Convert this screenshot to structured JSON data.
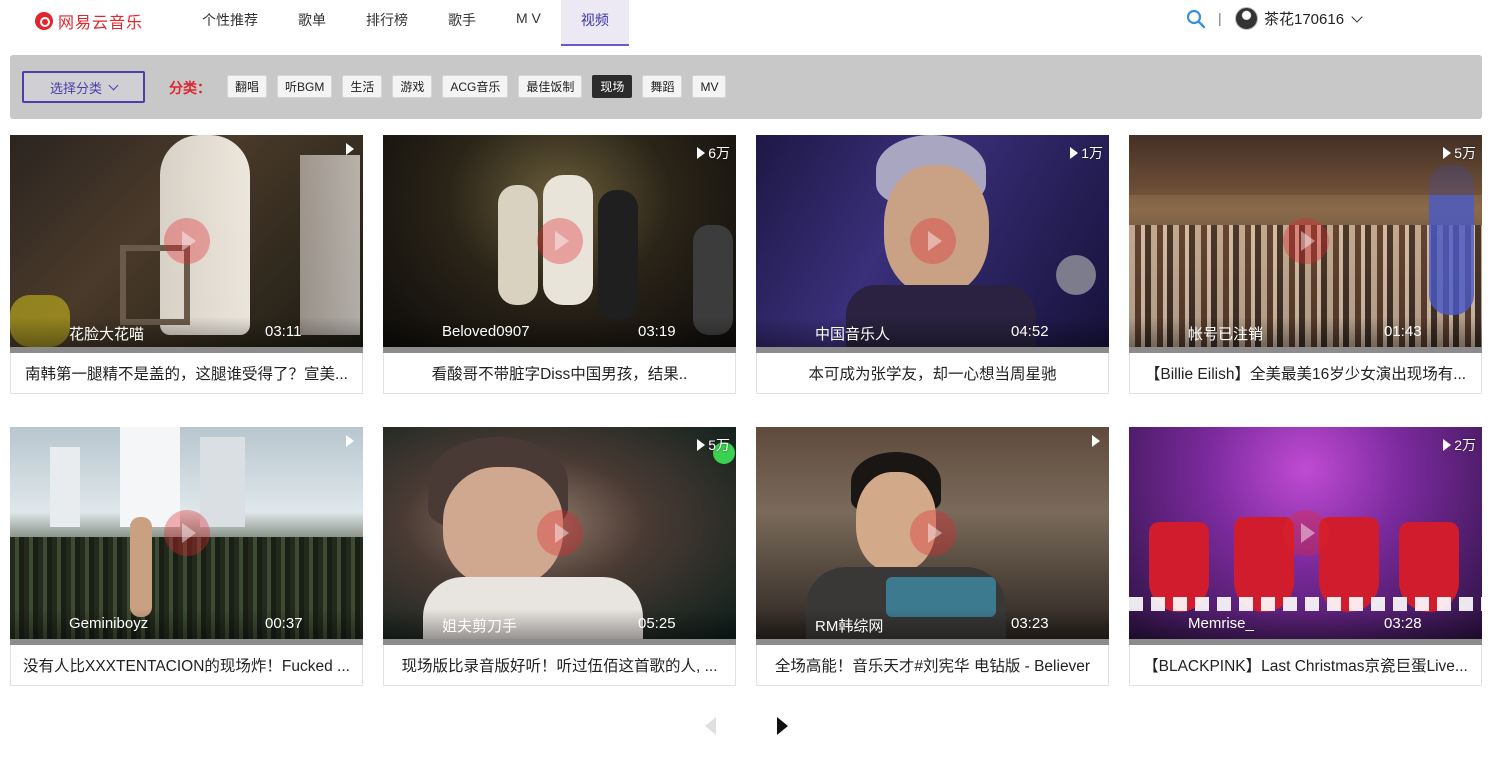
{
  "app": {
    "logo_text": "网易云音乐"
  },
  "nav": {
    "items": [
      "个性推荐",
      "歌单",
      "排行榜",
      "歌手",
      "M V",
      "视频"
    ],
    "active_index": 5
  },
  "header": {
    "divider": "|",
    "username": "茶花170616"
  },
  "filter": {
    "select_label": "选择分类",
    "label": "分类：",
    "tags": [
      "翻唱",
      "听BGM",
      "生活",
      "游戏",
      "ACG音乐",
      "最佳饭制",
      "现场",
      "舞蹈",
      "MV"
    ],
    "active_tag_index": 6
  },
  "videos": [
    {
      "views": "",
      "author": "花脸大花喵",
      "duration": "03:11",
      "title": "南韩第一腿精不是盖的，这腿谁受得了？宣美..."
    },
    {
      "views": "6万",
      "author": "Beloved0907",
      "duration": "03:19",
      "title": "看酸哥不带脏字Diss中国男孩，结果.."
    },
    {
      "views": "1万",
      "author": "中国音乐人",
      "duration": "04:52",
      "title": "本可成为张学友，却一心想当周星驰"
    },
    {
      "views": "5万",
      "author": "帐号已注销",
      "duration": "01:43",
      "title": "【Billie Eilish】全美最美16岁少女演出现场有..."
    },
    {
      "views": "",
      "author": "Geminiboyz",
      "duration": "00:37",
      "title": "没有人比XXXTENTACION的现场炸！Fucked ..."
    },
    {
      "views": "5万",
      "author": "姐夫剪刀手",
      "duration": "05:25",
      "title": "现场版比录音版好听！听过伍佰这首歌的人, ..."
    },
    {
      "views": "",
      "author": "RM韩综网",
      "duration": "03:23",
      "title": "全场高能！音乐天才#刘宪华 电钻版 - Believer"
    },
    {
      "views": "2万",
      "author": "Memrise_",
      "duration": "03:28",
      "title": "【BLACKPINK】Last Christmas京瓷巨蛋Live..."
    }
  ],
  "colors": {
    "brand": "#e1262d",
    "accent": "#4b3fa8"
  }
}
